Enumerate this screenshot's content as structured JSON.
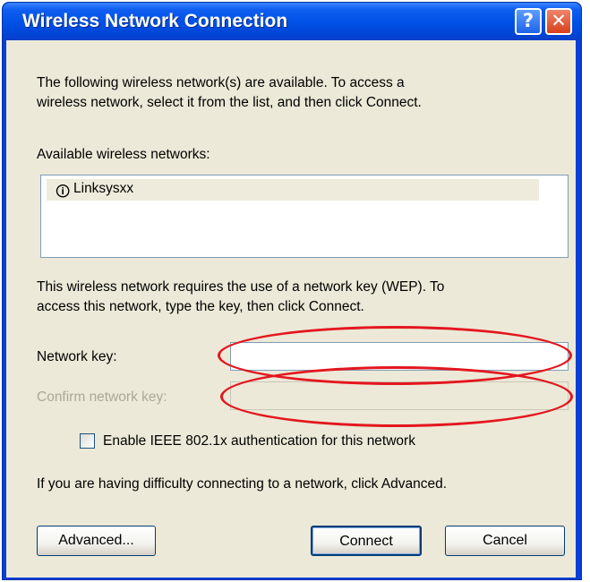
{
  "window": {
    "title": "Wireless Network Connection",
    "help_glyph": "?",
    "close_glyph": "✕"
  },
  "dialog": {
    "intro_line1": "The following wireless network(s) are available. To access a",
    "intro_line2": "wireless network, select it from the list, and then click Connect.",
    "available_label": "Available wireless networks:",
    "networks": [
      {
        "name": "Linksysxx",
        "icon": "antenna-icon"
      }
    ],
    "wep_line1": "This wireless network requires the use of a network key (WEP). To",
    "wep_line2": "access this network, type the key, then click Connect.",
    "network_key_label": "Network key:",
    "network_key_value": "",
    "confirm_key_label": "Confirm network key:",
    "confirm_key_value": "",
    "ieee_checkbox_label": "Enable IEEE 802.1x authentication for this network",
    "ieee_checked": false,
    "advanced_hint": "If you are having difficulty connecting to a network, click Advanced.",
    "advanced_button": "Advanced...",
    "connect_button": "Connect",
    "cancel_button": "Cancel"
  },
  "colors": {
    "annotation": "#e4161e",
    "titlebar": "#0050e6",
    "dialog_bg": "#ece9d8"
  }
}
